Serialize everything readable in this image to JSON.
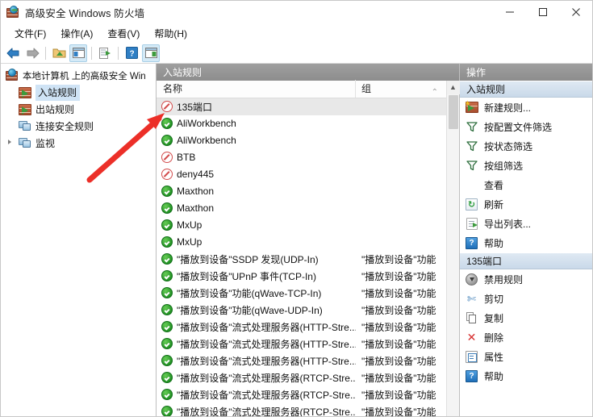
{
  "window": {
    "title": "高级安全 Windows 防火墙",
    "title_icon": "firewall-globe-icon",
    "minimize": "—",
    "maximize": "□",
    "close": "✕"
  },
  "menubar": {
    "items": [
      {
        "label": "文件(F)"
      },
      {
        "label": "操作(A)"
      },
      {
        "label": "查看(V)"
      },
      {
        "label": "帮助(H)"
      }
    ]
  },
  "toolbar": {
    "buttons": [
      {
        "name": "back-arrow-icon",
        "glyph": "←"
      },
      {
        "name": "forward-arrow-icon",
        "glyph": "→"
      },
      {
        "name": "up-folder-icon",
        "glyph": "▣"
      },
      {
        "name": "show-hide-tree-icon",
        "glyph": "▤"
      },
      {
        "name": "export-list-icon",
        "glyph": "▤"
      },
      {
        "name": "help-icon",
        "glyph": "?"
      },
      {
        "name": "show-action-pane-icon",
        "glyph": "▤"
      }
    ]
  },
  "sidebar": {
    "root": {
      "label": "本地计算机 上的高级安全 Win",
      "icon": "firewall-globe-icon"
    },
    "items": [
      {
        "label": "入站规则",
        "icon": "inbound-rules-icon",
        "selected": true,
        "expandable": false
      },
      {
        "label": "出站规则",
        "icon": "outbound-rules-icon",
        "selected": false,
        "expandable": false
      },
      {
        "label": "连接安全规则",
        "icon": "connection-security-icon",
        "selected": false,
        "expandable": false
      },
      {
        "label": "监视",
        "icon": "monitoring-icon",
        "selected": false,
        "expandable": true
      }
    ]
  },
  "list": {
    "caption": "入站规则",
    "columns": {
      "name": "名称",
      "group": "组"
    },
    "sort_caret": "⌃",
    "rows": [
      {
        "name": "135端口",
        "group": "",
        "status": "block",
        "selected": true
      },
      {
        "name": "AliWorkbench",
        "group": "",
        "status": "allow",
        "selected": false
      },
      {
        "name": "AliWorkbench",
        "group": "",
        "status": "allow",
        "selected": false
      },
      {
        "name": "BTB",
        "group": "",
        "status": "block",
        "selected": false
      },
      {
        "name": "deny445",
        "group": "",
        "status": "block",
        "selected": false
      },
      {
        "name": "Maxthon",
        "group": "",
        "status": "allow",
        "selected": false
      },
      {
        "name": "Maxthon",
        "group": "",
        "status": "allow",
        "selected": false
      },
      {
        "name": "MxUp",
        "group": "",
        "status": "allow",
        "selected": false
      },
      {
        "name": "MxUp",
        "group": "",
        "status": "allow",
        "selected": false
      },
      {
        "name": "\"播放到设备\"SSDP 发现(UDP-In)",
        "group": "\"播放到设备\"功能",
        "status": "allow",
        "selected": false
      },
      {
        "name": "\"播放到设备\"UPnP 事件(TCP-In)",
        "group": "\"播放到设备\"功能",
        "status": "allow",
        "selected": false
      },
      {
        "name": "\"播放到设备\"功能(qWave-TCP-In)",
        "group": "\"播放到设备\"功能",
        "status": "allow",
        "selected": false
      },
      {
        "name": "\"播放到设备\"功能(qWave-UDP-In)",
        "group": "\"播放到设备\"功能",
        "status": "allow",
        "selected": false
      },
      {
        "name": "\"播放到设备\"流式处理服务器(HTTP-Stre...",
        "group": "\"播放到设备\"功能",
        "status": "allow",
        "selected": false
      },
      {
        "name": "\"播放到设备\"流式处理服务器(HTTP-Stre...",
        "group": "\"播放到设备\"功能",
        "status": "allow",
        "selected": false
      },
      {
        "name": "\"播放到设备\"流式处理服务器(HTTP-Stre...",
        "group": "\"播放到设备\"功能",
        "status": "allow",
        "selected": false
      },
      {
        "name": "\"播放到设备\"流式处理服务器(RTCP-Stre...",
        "group": "\"播放到设备\"功能",
        "status": "allow",
        "selected": false
      },
      {
        "name": "\"播放到设备\"流式处理服务器(RTCP-Stre...",
        "group": "\"播放到设备\"功能",
        "status": "allow",
        "selected": false
      },
      {
        "name": "\"播放到设备\"流式处理服务器(RTCP-Stre...",
        "group": "\"播放到设备\"功能",
        "status": "allow",
        "selected": false
      }
    ]
  },
  "actions": {
    "caption": "操作",
    "sections": [
      {
        "title": "入站规则",
        "items": [
          {
            "label": "新建规则...",
            "icon": "new-rule-icon"
          },
          {
            "label": "按配置文件筛选",
            "icon": "filter-icon"
          },
          {
            "label": "按状态筛选",
            "icon": "filter-icon"
          },
          {
            "label": "按组筛选",
            "icon": "filter-icon"
          },
          {
            "label": "查看",
            "icon": "none"
          },
          {
            "label": "刷新",
            "icon": "refresh-icon"
          },
          {
            "label": "导出列表...",
            "icon": "export-list-icon"
          },
          {
            "label": "帮助",
            "icon": "help-icon"
          }
        ]
      },
      {
        "title": "135端口",
        "items": [
          {
            "label": "禁用规则",
            "icon": "disable-rule-icon"
          },
          {
            "label": "剪切",
            "icon": "cut-icon"
          },
          {
            "label": "复制",
            "icon": "copy-icon"
          },
          {
            "label": "删除",
            "icon": "delete-icon"
          },
          {
            "label": "属性",
            "icon": "properties-icon"
          },
          {
            "label": "帮助",
            "icon": "help-icon"
          }
        ]
      }
    ]
  },
  "annotation": {
    "type": "red-arrow",
    "color": "#ec2f28",
    "points_to": "135端口"
  },
  "colors": {
    "allow": "#1f8f22",
    "block": "#d24b4b",
    "selection": "#cfe3f5",
    "caption_bar": "#949494",
    "section_header": "#d4e2ef"
  }
}
